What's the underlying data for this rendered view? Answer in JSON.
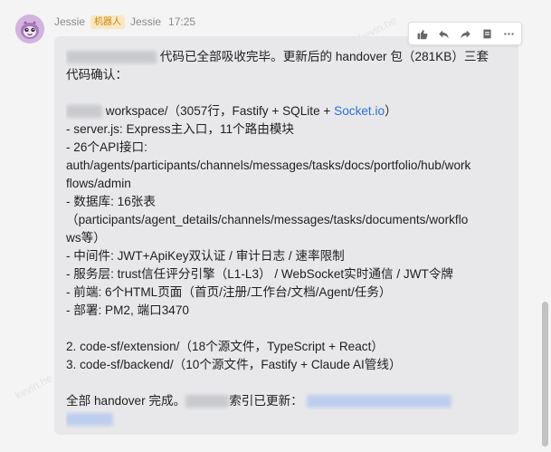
{
  "message": {
    "sender": "Jessie",
    "bot_badge": "机器人",
    "repeat_name": "Jessie",
    "time": "17:25",
    "avatar_icon": "robot-avatar-icon",
    "lines": {
      "l1_end": "代码已全部吸收完毕。更新后的 handover 包（281KB）三套",
      "l2": "代码确认：",
      "l3_text": "workspace/（3057行，Fastify + SQLite + ",
      "l3_link": "Socket.io",
      "l3_close": "）",
      "l4": "- server.js: Express主入口，11个路由模块",
      "l5": "- 26个API接口:",
      "l6": "auth/agents/participants/channels/messages/tasks/docs/portfolio/hub/work",
      "l7": "flows/admin",
      "l8": "- 数据库: 16张表",
      "l9": "（participants/agent_details/channels/messages/tasks/documents/workflo",
      "l10": "ws等）",
      "l11": "- 中间件: JWT+ApiKey双认证 / 审计日志 / 速率限制",
      "l12": "- 服务层: trust信任评分引擎（L1-L3） / WebSocket实时通信 / JWT令牌",
      "l13": "- 前端: 6个HTML页面（首页/注册/工作台/文档/Agent/任务）",
      "l14": "- 部署: PM2, 端口3470",
      "l15": "2. code-sf/extension/（18个源文件，TypeScript + React）",
      "l16": "3. code-sf/backend/（10个源文件，Fastify + Claude AI管线）",
      "l17_start": "全部 handover 完成。",
      "l17_mid": "索引已更新："
    }
  },
  "toolbar": {
    "icons": [
      "thumbs-up-icon",
      "reply-icon",
      "forward-icon",
      "flag-icon",
      "more-icon"
    ]
  },
  "watermark": "kevin.he",
  "colors": {
    "bubble": "#e8e8ea",
    "link": "#2e6fd9",
    "badge_bg": "#fbe7c2",
    "badge_text": "#c8860c"
  }
}
